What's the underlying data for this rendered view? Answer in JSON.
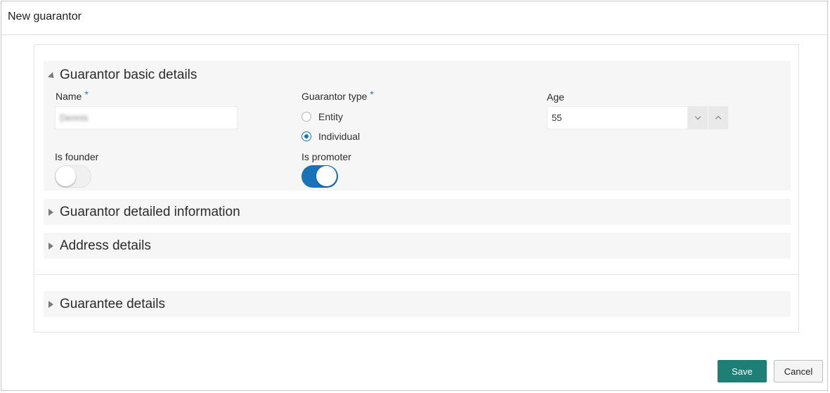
{
  "dialog": {
    "title": "New guarantor"
  },
  "sections": {
    "basic": {
      "title": "Guarantor basic details",
      "expanded": true,
      "name": {
        "label": "Name",
        "required_mark": "*",
        "value": "Dennis"
      },
      "guarantor_type": {
        "label": "Guarantor type",
        "required_mark": "*",
        "options": [
          "Entity",
          "Individual"
        ],
        "selected": "Individual"
      },
      "age": {
        "label": "Age",
        "value": "55"
      },
      "is_founder": {
        "label": "Is founder",
        "on": false
      },
      "is_promoter": {
        "label": "Is promoter",
        "on": true
      }
    },
    "detailed": {
      "title": "Guarantor detailed information",
      "expanded": false
    },
    "address": {
      "title": "Address details",
      "expanded": false
    },
    "guarantee": {
      "title": "Guarantee details",
      "expanded": false
    }
  },
  "footer": {
    "save_label": "Save",
    "cancel_label": "Cancel"
  },
  "colors": {
    "accent": "#1a73b8",
    "save_button": "#1d7f75",
    "section_bg": "#f6f6f6"
  }
}
